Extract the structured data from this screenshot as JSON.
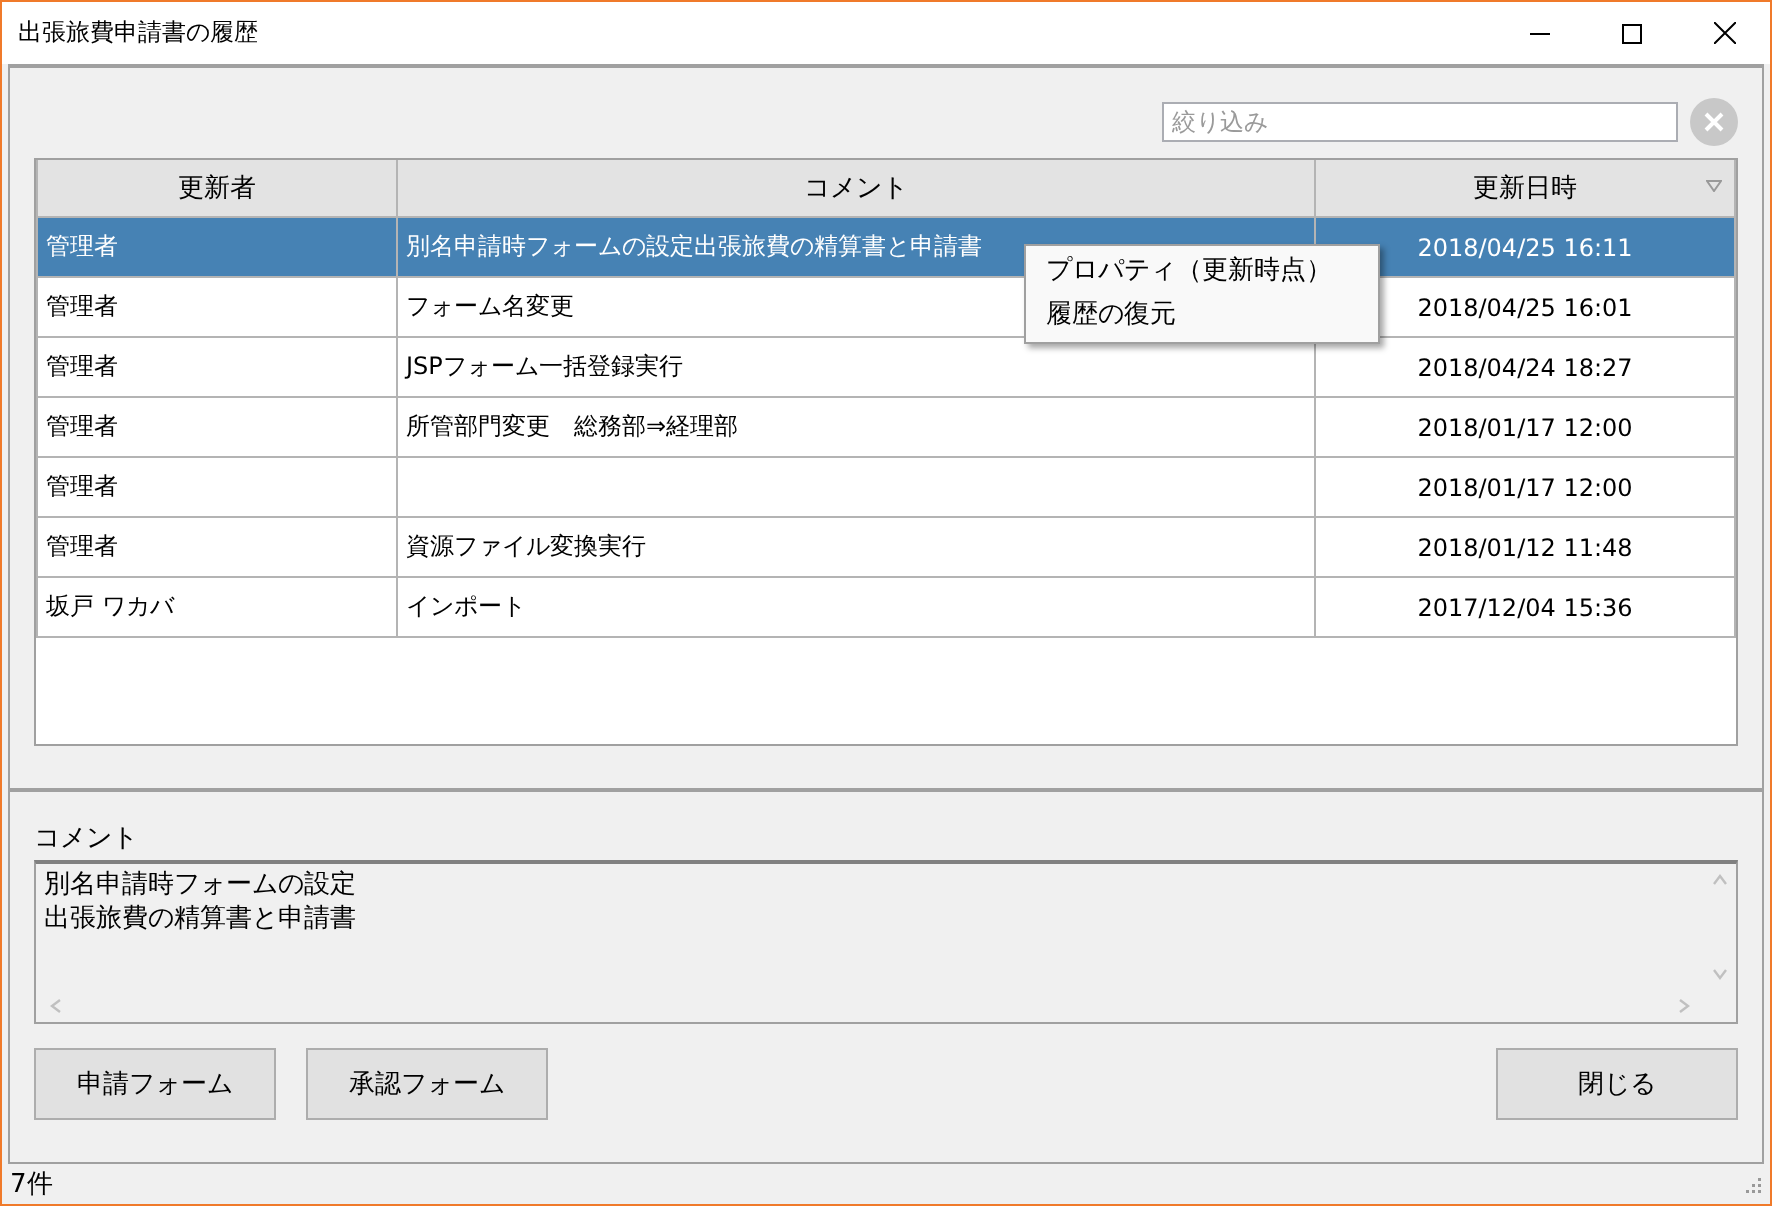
{
  "window": {
    "title": "出張旅費申請書の履歴"
  },
  "filter": {
    "placeholder": "絞り込み"
  },
  "table": {
    "columns": [
      {
        "label": "更新者",
        "sorted": false
      },
      {
        "label": "コメント",
        "sorted": false
      },
      {
        "label": "更新日時",
        "sorted": true
      }
    ],
    "rows": [
      {
        "user": "管理者",
        "comment": "別名申請時フォームの設定出張旅費の精算書と申請書",
        "date": "2018/04/25 16:11",
        "selected": true
      },
      {
        "user": "管理者",
        "comment": "フォーム名変更",
        "date": "2018/04/25 16:01",
        "selected": false
      },
      {
        "user": "管理者",
        "comment": "JSPフォーム一括登録実行",
        "date": "2018/04/24 18:27",
        "selected": false
      },
      {
        "user": "管理者",
        "comment": "所管部門変更　総務部⇒経理部",
        "date": "2018/01/17 12:00",
        "selected": false
      },
      {
        "user": "管理者",
        "date": "2018/01/17 12:00",
        "selected": false
      },
      {
        "user": "管理者",
        "comment": "資源ファイル変換実行",
        "date": "2018/01/12 11:48",
        "selected": false
      },
      {
        "user": "坂戸 ワカバ",
        "comment": "インポート",
        "date": "2017/12/04 15:36",
        "selected": false
      }
    ]
  },
  "context_menu": {
    "items": [
      "プロパティ（更新時点）",
      "履歴の復元"
    ]
  },
  "comment_panel": {
    "label": "コメント",
    "lines": [
      "別名申請時フォームの設定",
      "出張旅費の精算書と申請書"
    ]
  },
  "buttons": {
    "left": [
      "申請フォーム",
      "承認フォーム"
    ],
    "right": [
      "閉じる"
    ]
  },
  "status_bar": {
    "text": "7件"
  }
}
